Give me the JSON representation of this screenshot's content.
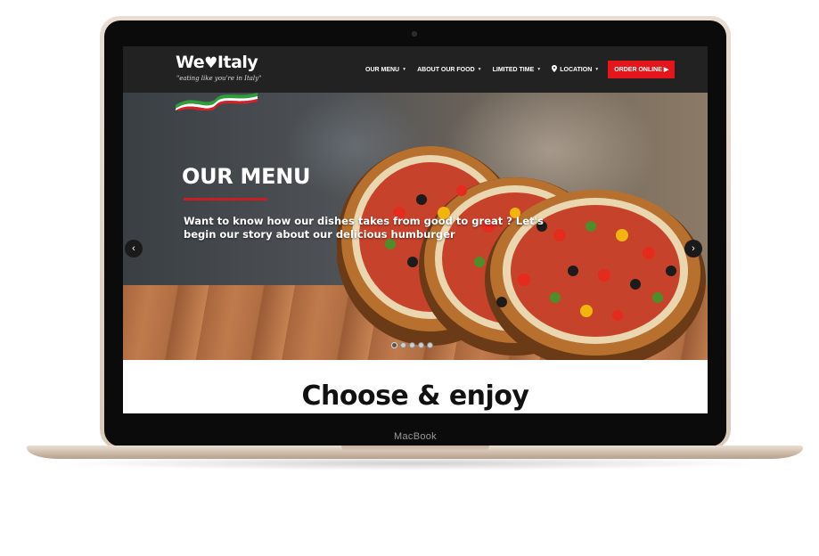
{
  "device": {
    "brand_label": "MacBook"
  },
  "site": {
    "logo_text": "We",
    "logo_text_2": "Italy",
    "logo_heart": "♥",
    "tagline": "\"eating like you're in Italy\"",
    "flag_colors": [
      "#2e9d3a",
      "#ffffff",
      "#d81e27"
    ]
  },
  "nav": {
    "items": [
      {
        "label": "OUR MENU",
        "icon": "chevron-down-icon"
      },
      {
        "label": "ABOUT OUR FOOD",
        "icon": "chevron-down-icon"
      },
      {
        "label": "LIMITED TIME",
        "icon": "chevron-down-icon"
      },
      {
        "label": "LOCATION",
        "icon": "chevron-down-icon",
        "leading_icon": "map-pin-icon"
      }
    ],
    "order_button": "ORDER ONLINE",
    "order_button_color": "#e4161b"
  },
  "hero": {
    "title": "OUR MENU",
    "text": "Want to know how our dishes takes from good to great ? Let's begin our story about our delicious humburger",
    "prev_icon": "‹",
    "next_icon": "›",
    "slide_count": 5,
    "active_slide": 1,
    "accent_color": "#c81d22"
  },
  "section": {
    "heading": "Choose & enjoy"
  }
}
